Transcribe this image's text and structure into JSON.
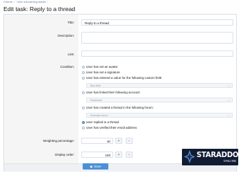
{
  "breadcrumb": [
    "Criteria",
    "User onboarding ladder"
  ],
  "page_title": "Edit task: Reply to a thread",
  "form": {
    "title_label": "Title:",
    "title_value": "Reply to a thread",
    "description_label": "Description:",
    "description_value": "",
    "link_label": "Link:",
    "link_value": "",
    "condition_label": "Condition:",
    "conditions": [
      {
        "label": "User has set an avatar",
        "checked": false
      },
      {
        "label": "User has set a signature",
        "checked": false
      },
      {
        "label": "User has entered a value for the following custom field:",
        "checked": false
      },
      {
        "label": "User has linked their following account:",
        "checked": false
      },
      {
        "label": "User has created a thread in the following forum:",
        "checked": false
      },
      {
        "label": "User replied to a thread",
        "checked": true
      },
      {
        "label": "User has verified their email address",
        "checked": false
      }
    ],
    "custom_field_select": "Bad field",
    "account_select": "Facebook",
    "forum_select": "Example forum",
    "weighting_label": "Weighting percentage:",
    "weighting_value": "40",
    "display_order_label": "Display order:",
    "display_order_value": "100",
    "increment_symbol": "+",
    "decrement_symbol": "−",
    "save_label": "Save"
  },
  "brand": {
    "name": "STARADDONS",
    "sub": "ONLINE"
  },
  "colors": {
    "accent": "#4b90d6",
    "checked_radio": "#3b77b8",
    "brand_bg": "#111c33"
  }
}
